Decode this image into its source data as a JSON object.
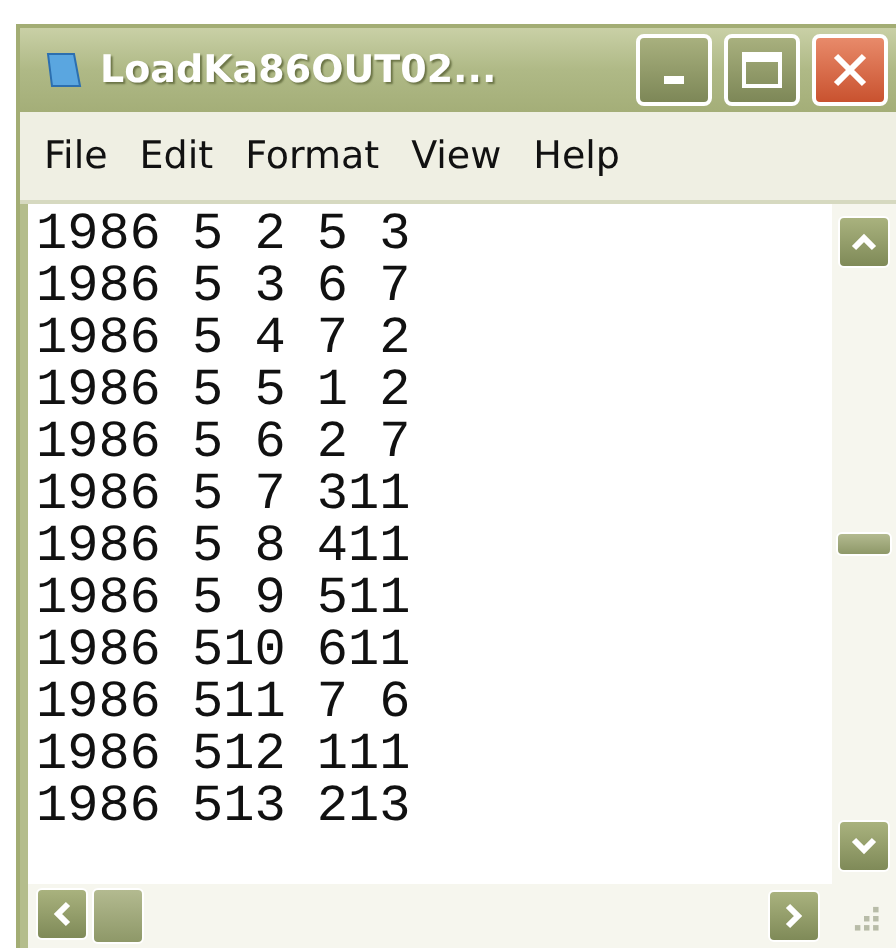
{
  "window": {
    "title": "LoadKa86OUT02..."
  },
  "menu": [
    "File",
    "Edit",
    "Format",
    "View",
    "Help"
  ],
  "lines": [
    "1986 5 2 5 3",
    "1986 5 3 6 7",
    "1986 5 4 7 2",
    "1986 5 5 1 2",
    "1986 5 6 2 7",
    "1986 5 7 311",
    "1986 5 8 411",
    "1986 5 9 511",
    "1986 510 611",
    "1986 511 7 6",
    "1986 512 111",
    "1986 513 213"
  ]
}
